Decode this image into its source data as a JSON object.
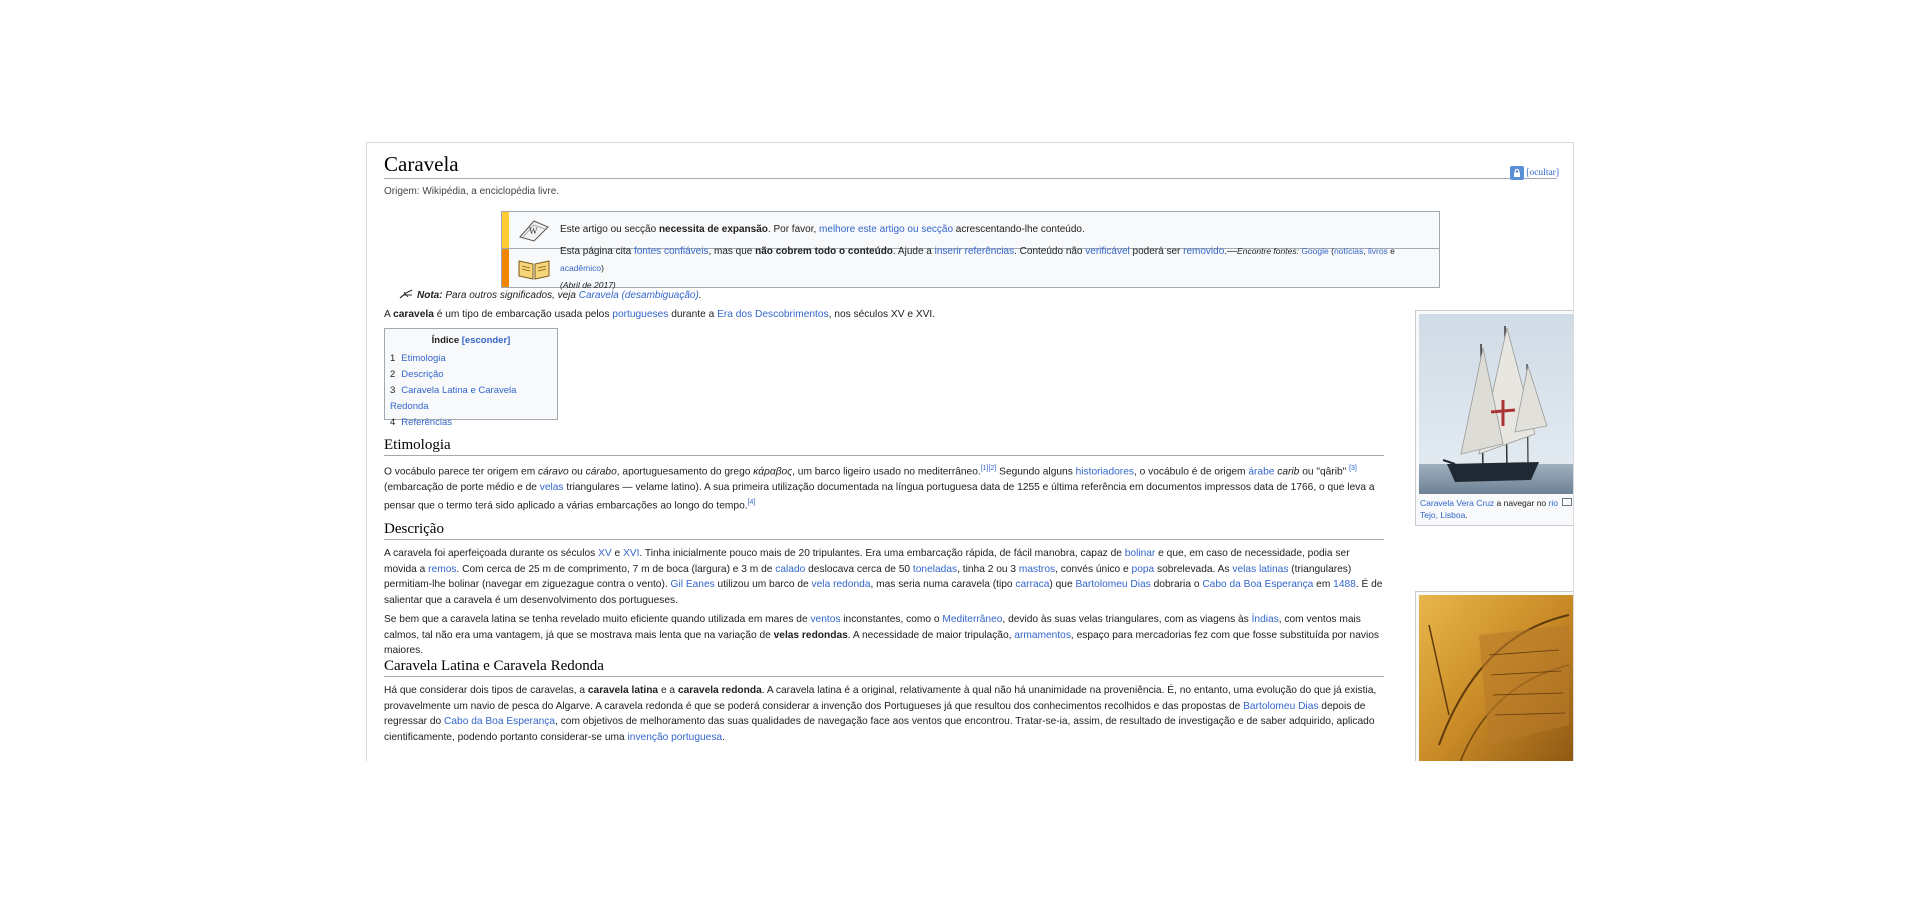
{
  "article": {
    "title": "Caravela",
    "hide_label": "[ocultar]",
    "site_sub": "Origem: Wikipédia, a enciclopédia livre."
  },
  "notices": {
    "expand": {
      "t1": "Este artigo ou secção ",
      "bold": "necessita de expansão",
      "t2": ". Por favor, ",
      "link": "melhore este artigo ou secção",
      "t3": " acrescentando-lhe conteúdo."
    },
    "sources": {
      "t1": "Esta página cita ",
      "link1": "fontes confiáveis",
      "t2": ", mas que ",
      "bold": "não cobrem todo o conteúdo",
      "t3": ". Ajude a ",
      "link2": "inserir referências",
      "t4": ". Conteúdo não ",
      "link3": "verificável",
      "t5": " poderá ser ",
      "link4": "removido",
      "t6": ".—",
      "find": "Encontre fontes: ",
      "google": "Google",
      "paren_open": " (",
      "news": "notícias",
      "comma": ", ",
      "books": "livros",
      "and": " e ",
      "academic": "acadêmico",
      "paren_close": ")",
      "date": "(Abril de 2017)"
    },
    "colors": {
      "expand_bar": "#fc3",
      "sources_bar": "#f28500"
    }
  },
  "hatnote": {
    "label": "Nota:",
    "text": " Para outros significados, veja ",
    "link": "Caravela (desambiguação)",
    "end": "."
  },
  "intro": {
    "t1": "A ",
    "bold": "caravela",
    "t2": " é um tipo de embarcação usada pelos ",
    "link1": "portugueses",
    "t3": " durante a ",
    "link2": "Era dos Descobrimentos",
    "t4": ", nos séculos XV e XVI."
  },
  "toc": {
    "title": "Índice",
    "toggle": "[esconder]",
    "items": [
      {
        "num": "1",
        "label": "Etimologia"
      },
      {
        "num": "2",
        "label": "Descrição"
      },
      {
        "num": "3",
        "label": "Caravela Latina e Caravela Redonda"
      },
      {
        "num": "4",
        "label": "Referências"
      }
    ]
  },
  "sections": {
    "etimologia": {
      "heading": "Etimologia",
      "p": {
        "t1": "O vocábulo parece ter origem em ",
        "i1": "cáravo",
        "t2": " ou ",
        "i2": "cárabo",
        "t3": ", aportuguesamento do grego ",
        "i3": "κάραβος",
        "t4": ", um barco ligeiro usado no mediterrâneo.",
        "ref1": "[1]",
        "ref2": "[2]",
        "t5": " Segundo alguns ",
        "link1": "historiadores",
        "t6": ", o vocábulo é de origem ",
        "link2": "árabe",
        "t7": " ",
        "i4": "carib",
        "t8": " ou \"qârib\" ",
        "ref3": "[3]",
        "t9": " (embarcação de porte médio e de ",
        "link3": "velas",
        "t10": " triangulares — velame latino). A sua primeira utilização documentada na língua portuguesa data de 1255 e última referência em documentos impressos data de 1766, o que leva a pensar que o termo terá sido aplicado a várias embarcações ao longo do tempo.",
        "ref4": "[4]"
      }
    },
    "descricao": {
      "heading": "Descrição",
      "p1": {
        "t1": "A caravela foi aperfeiçoada durante os séculos ",
        "l1": "XV",
        "t2": " e ",
        "l2": "XVI",
        "t3": ". Tinha inicialmente pouco mais de 20 tripulantes. Era uma embarcação rápida, de fácil manobra, capaz de ",
        "l3": "bolinar",
        "t4": " e que, em caso de necessidade, podia ser movida a ",
        "l4": "remos",
        "t5": ". Com cerca de 25 m de comprimento, 7 m de boca (largura) e 3 m de ",
        "l5": "calado",
        "t6": " deslocava cerca de 50 ",
        "l6": "toneladas",
        "t7": ", tinha 2 ou 3 ",
        "l7": "mastros",
        "t8": ", convés único e ",
        "l8": "popa",
        "t9": " sobrelevada. As ",
        "l9": "velas latinas",
        "t10": " (triangulares) permitiam-lhe bolinar (navegar em ziguezague contra o vento). ",
        "l10": "Gil Eanes",
        "t11": " utilizou um barco de ",
        "l11": "vela redonda",
        "t12": ", mas seria numa caravela (tipo ",
        "l12": "carraca",
        "t13": ") que ",
        "l13": "Bartolomeu Dias",
        "t14": " dobraria o ",
        "l14": "Cabo da Boa Esperança",
        "t15": " em ",
        "l15": "1488",
        "t16": ". É de salientar que a caravela é um desenvolvimento dos portugueses."
      },
      "p2": {
        "t1": "Se bem que a caravela latina se tenha revelado muito eficiente quando utilizada em mares de ",
        "l1": "ventos",
        "t2": " inconstantes, como o ",
        "l2": "Mediterrâneo",
        "t3": ", devido às suas velas triangulares, com as viagens às ",
        "l3": "Índias",
        "t4": ", com ventos mais calmos, tal não era uma vantagem, já que se mostrava mais lenta que na variação de ",
        "b1": "velas redondas",
        "t5": ". A necessidade de maior tripulação, ",
        "l4": "armamentos",
        "t6": ", espaço para mercadorias fez com que fosse substituída por navios maiores."
      }
    },
    "latina": {
      "heading": "Caravela Latina e Caravela Redonda",
      "p": {
        "t1": "Há que considerar dois tipos de caravelas, a ",
        "b1": "caravela latina",
        "t2": " e a ",
        "b2": "caravela redonda",
        "t3": ". A caravela latina é a original, relativamente à qual não há unanimidade na proveniência. É, no entanto, uma evolução do que já existia, provavelmente um navio de pesca do Algarve. A caravela redonda é que se poderá considerar a invenção dos Portugueses já que resultou dos conhecimentos recolhidos e das propostas de ",
        "l1": "Bartolomeu Dias",
        "t4": " depois de regressar do ",
        "l2": "Cabo da Boa Esperança",
        "t5": ", com objetivos de melhoramento das suas qualidades de navegação face aos ventos que encontrou. Tratar-se-ia, assim, de resultado de investigação e de saber adquirido, aplicado cientificamente, podendo portanto considerar-se uma ",
        "l3": "invenção portuguesa",
        "t6": "."
      }
    }
  },
  "thumb1": {
    "caption_link": "Caravela Vera Cruz",
    "caption_text": " a navegar no ",
    "caption_link2": "rio Tejo, Lisboa",
    "caption_end": "."
  },
  "theme": {
    "link": "#3366cc",
    "border": "#a2a9b1"
  }
}
